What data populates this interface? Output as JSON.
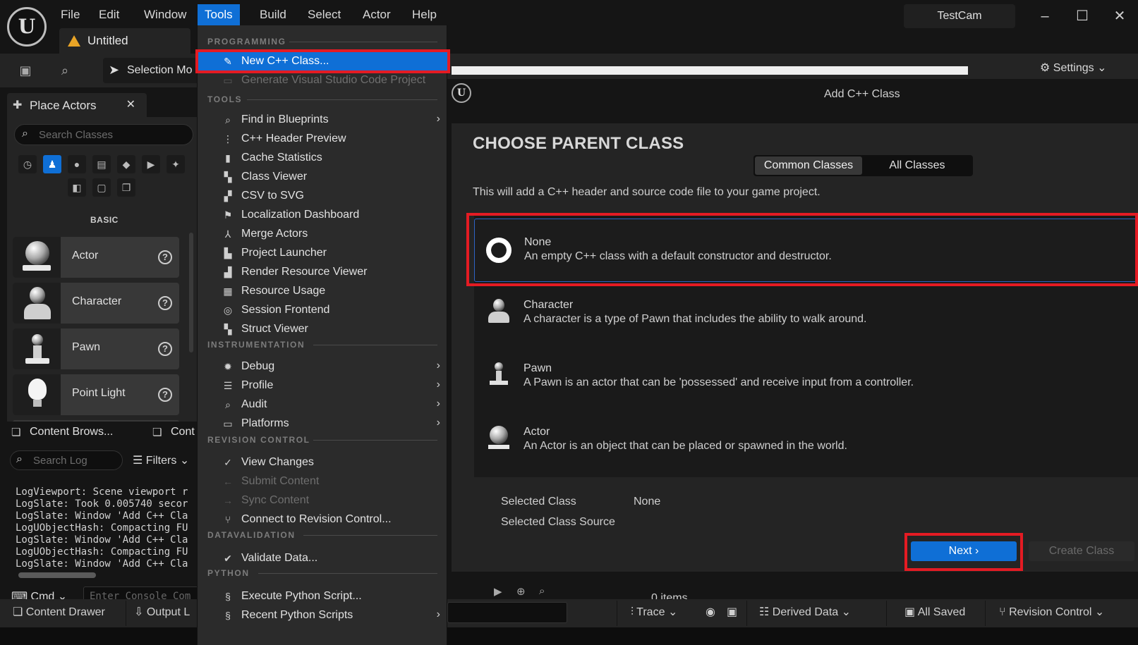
{
  "menubar": {
    "items": [
      "File",
      "Edit",
      "Window",
      "Tools",
      "Build",
      "Select",
      "Actor",
      "Help"
    ],
    "active": "Tools"
  },
  "document_tab": "Untitled",
  "project_name": "TestCam",
  "window_controls": {
    "minimize": "–",
    "maximize": "☐",
    "close": "✕"
  },
  "toolbar": {
    "selection_mode": "Selection Mo",
    "settings": "Settings"
  },
  "place_actors": {
    "tab_label": "Place Actors",
    "search_placeholder": "Search Classes",
    "category_label": "BASIC",
    "items": [
      "Actor",
      "Character",
      "Pawn",
      "Point Light"
    ]
  },
  "bottom_tabs": {
    "content_browser": "Content Brows...",
    "cont": "Cont"
  },
  "output_log": {
    "search_placeholder": "Search Log",
    "filters": "Filters",
    "lines": [
      "LogViewport: Scene viewport r",
      "LogSlate: Took 0.005740 secor",
      "LogSlate: Window 'Add C++ Cla",
      "LogUObjectHash: Compacting FU",
      "LogSlate: Window 'Add C++ Cla",
      "LogUObjectHash: Compacting FU",
      "LogSlate: Window 'Add C++ Cla"
    ],
    "cmd_label": "Cmd",
    "console_placeholder": "Enter Console Com"
  },
  "statusbar": {
    "content_drawer": "Content Drawer",
    "output_log": "Output L",
    "trace": "Trace",
    "derived_data": "Derived Data",
    "all_saved": "All Saved",
    "revision_control": "Revision Control"
  },
  "behind": {
    "items_count": "0 items"
  },
  "tools_menu": {
    "sections": [
      {
        "header": "PROGRAMMING",
        "items": [
          {
            "label": "New C++ Class...",
            "icon": "cpp-class-icon",
            "highlighted": true
          },
          {
            "label": "Generate Visual Studio Code Project",
            "icon": "vscode-icon",
            "disabled": true
          }
        ]
      },
      {
        "header": "TOOLS",
        "items": [
          {
            "label": "Find in Blueprints",
            "icon": "search-icon",
            "submenu": true
          },
          {
            "label": "C++ Header Preview",
            "icon": "hierarchy-icon"
          },
          {
            "label": "Cache Statistics",
            "icon": "bar-chart-icon"
          },
          {
            "label": "Class Viewer",
            "icon": "class-viewer-icon"
          },
          {
            "label": "CSV to SVG",
            "icon": "csv-icon"
          },
          {
            "label": "Localization Dashboard",
            "icon": "flag-icon"
          },
          {
            "label": "Merge Actors",
            "icon": "merge-icon"
          },
          {
            "label": "Project Launcher",
            "icon": "launcher-icon"
          },
          {
            "label": "Render Resource Viewer",
            "icon": "render-icon"
          },
          {
            "label": "Resource Usage",
            "icon": "table-icon"
          },
          {
            "label": "Session Frontend",
            "icon": "session-icon"
          },
          {
            "label": "Struct Viewer",
            "icon": "struct-icon"
          }
        ]
      },
      {
        "header": "INSTRUMENTATION",
        "items": [
          {
            "label": "Debug",
            "icon": "bug-icon",
            "submenu": true
          },
          {
            "label": "Profile",
            "icon": "profile-icon",
            "submenu": true
          },
          {
            "label": "Audit",
            "icon": "audit-icon",
            "submenu": true
          },
          {
            "label": "Platforms",
            "icon": "platforms-icon",
            "submenu": true
          }
        ]
      },
      {
        "header": "REVISION CONTROL",
        "items": [
          {
            "label": "View Changes",
            "icon": "check-circle-icon"
          },
          {
            "label": "Submit Content",
            "icon": "arrow-left-icon",
            "disabled": true
          },
          {
            "label": "Sync Content",
            "icon": "arrow-right-icon",
            "disabled": true
          },
          {
            "label": "Connect to Revision Control...",
            "icon": "branch-icon"
          }
        ]
      },
      {
        "header": "DATAVALIDATION",
        "items": [
          {
            "label": "Validate Data...",
            "icon": "validate-icon"
          }
        ]
      },
      {
        "header": "PYTHON",
        "items": [
          {
            "label": "Execute Python Script...",
            "icon": "python-icon"
          },
          {
            "label": "Recent Python Scripts",
            "icon": "python-recent-icon",
            "submenu": true
          }
        ]
      }
    ]
  },
  "dialog": {
    "title": "Add C++ Class",
    "heading": "CHOOSE PARENT CLASS",
    "tabs": [
      "Common Classes",
      "All Classes"
    ],
    "active_tab": "Common Classes",
    "intro": "This will add a C++ header and source code file to your game project.",
    "classes": [
      {
        "name": "None",
        "desc": "An empty C++ class with a default constructor and destructor.",
        "icon": "radio-icon",
        "selected": true
      },
      {
        "name": "Character",
        "desc": "A character is a type of Pawn that includes the ability to walk around.",
        "icon": "character-icon"
      },
      {
        "name": "Pawn",
        "desc": "A Pawn is an actor that can be 'possessed' and receive input from a controller.",
        "icon": "pawn-icon"
      },
      {
        "name": "Actor",
        "desc": "An Actor is an object that can be placed or spawned in the world.",
        "icon": "actor-sphere-icon"
      }
    ],
    "selected_class_label": "Selected Class",
    "selected_class_value": "None",
    "selected_class_source_label": "Selected Class Source",
    "next_button": "Next",
    "create_button": "Create Class"
  },
  "colors": {
    "accent": "#0f6fd6",
    "highlight_box": "#e41b23",
    "panel": "#242424",
    "background": "#151515"
  }
}
